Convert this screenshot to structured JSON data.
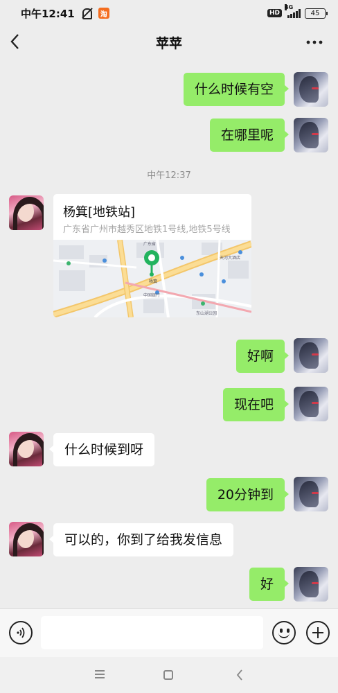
{
  "status_bar": {
    "time": "中午12:41",
    "app_badge": "淘",
    "hd_label": "HD",
    "network": "4G",
    "battery": "45"
  },
  "header": {
    "title": "苹苹"
  },
  "messages": [
    {
      "sender": "me",
      "text": "什么时候有空"
    },
    {
      "sender": "me",
      "text": "在哪里呢"
    },
    {
      "type": "time",
      "text": "中午12:37"
    },
    {
      "sender": "her",
      "type": "location",
      "name": "杨箕[地铁站]",
      "address": "广东省广州市越秀区地铁1号线,地铁5号线"
    },
    {
      "sender": "me",
      "text": "好啊"
    },
    {
      "sender": "me",
      "text": "现在吧"
    },
    {
      "sender": "her",
      "text": "什么时候到呀"
    },
    {
      "sender": "me",
      "text": "20分钟到"
    },
    {
      "sender": "her",
      "text": "可以的，你到了给我发信息"
    },
    {
      "sender": "me",
      "text": "好"
    }
  ],
  "map_labels": {
    "subway_station": "杨箕",
    "station_hall": "广东省",
    "hotel": "天河大酒店",
    "bank": "中国银行",
    "parking": "东山湖公园"
  },
  "input": {
    "value": "",
    "placeholder": ""
  },
  "colors": {
    "my_bubble": "#95ec69",
    "her_bubble": "#ffffff",
    "background": "#ededed",
    "map_pin": "#22b35e"
  }
}
